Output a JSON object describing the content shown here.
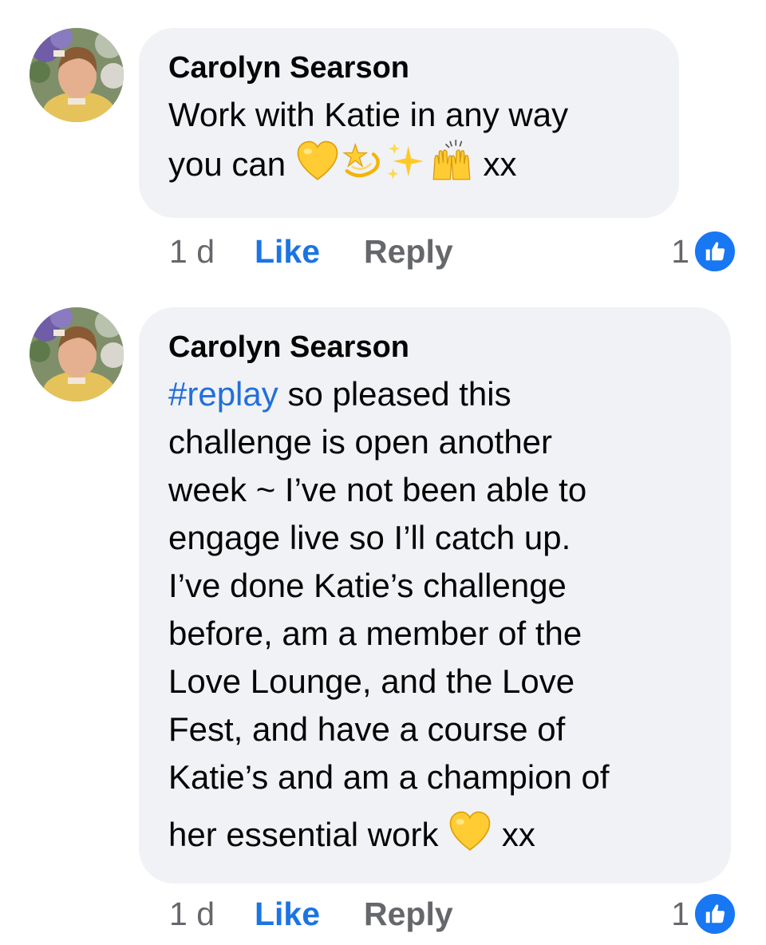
{
  "comments": [
    {
      "author": "Carolyn Searson",
      "text_segments": [
        "Work with Katie in any way",
        "you can"
      ],
      "emoji_icons": [
        "yellow-heart-icon",
        "dizzy-icon",
        "sparkles-icon",
        "raising-hands-icon"
      ],
      "trailing": "xx",
      "time": "1 d",
      "like_label": "Like",
      "reply_label": "Reply",
      "reaction_count": "1"
    },
    {
      "author": "Carolyn Searson",
      "hashtag": "#replay",
      "lines": [
        "so pleased this",
        "challenge is open another",
        "week ~ I’ve not been able to",
        "engage live so I’ll catch up.",
        "I’ve done Katie’s challenge",
        "before, am a member of the",
        "Love Lounge, and the Love",
        "Fest, and have a course of",
        "Katie’s and am a champion of",
        "her essential work"
      ],
      "emoji_icons": [
        "yellow-heart-icon"
      ],
      "trailing": "xx",
      "time": "1 d",
      "like_label": "Like",
      "reply_label": "Reply",
      "reaction_count": "1"
    }
  ],
  "colors": {
    "bubble": "#f0f2f5",
    "like_blue": "#1b74e4",
    "hashtag_blue": "#216fdb",
    "meta_gray": "#65676b"
  }
}
